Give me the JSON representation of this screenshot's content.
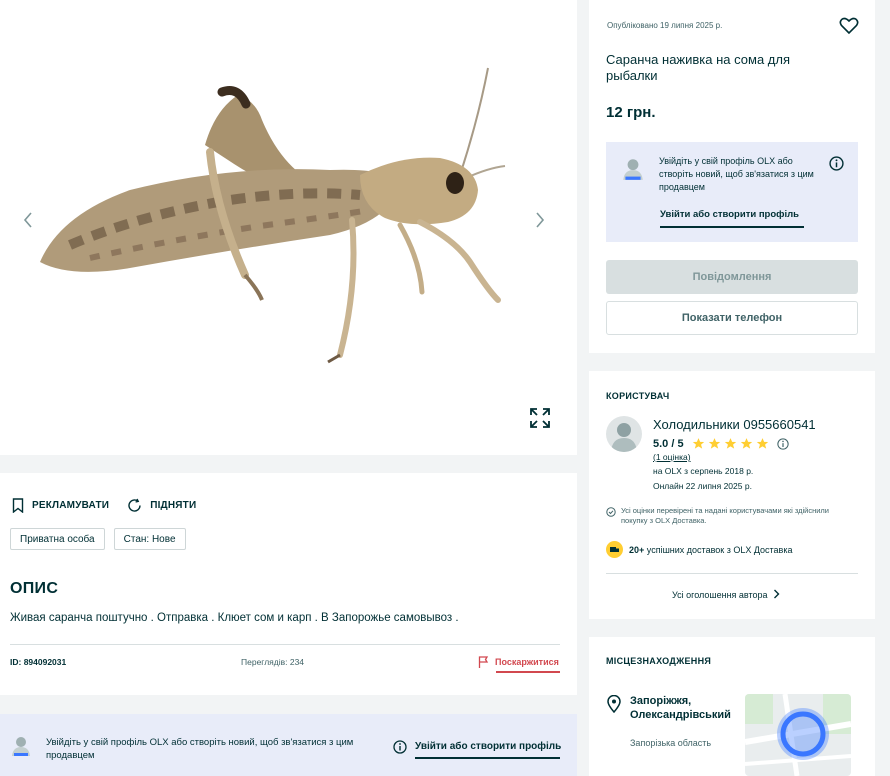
{
  "gallery": {
    "prev_icon": "chevron-left-icon",
    "next_icon": "chevron-right-icon",
    "expand_icon": "expand-icon"
  },
  "details": {
    "promote_label": "РЕКЛАМУВАТИ",
    "raise_label": "ПІДНЯТИ",
    "tags": [
      "Приватна особа",
      "Стан: Нове"
    ],
    "section_title": "ОПИС",
    "description": "Живая саранча поштучно . Отправка . Клюет сом и карп . В Запорожье самовывоз .",
    "id": "ID: 894092031",
    "views": "Переглядів: 234",
    "report_label": "Поскаржитися"
  },
  "banner": {
    "text": "Увійдіть у свій профіль OLX або створіть новий, щоб зв'язатися з цим продавцем",
    "link": "Увійти або створити профіль"
  },
  "listing": {
    "published": "Опубліковано 19 липня 2025 р.",
    "title": "Саранча наживка на сома для рыбалки",
    "price": "12 грн.",
    "login_text": "Увійдіть у свій профіль OLX або створіть новий, щоб зв'язатися з цим продавцем",
    "login_link": "Увійти або створити профіль",
    "message_button": "Повідомлення",
    "phone_button": "Показати телефон"
  },
  "user": {
    "section_label": "КОРИСТУВАЧ",
    "name": "Холодильники 0955660541",
    "rating": "5.0 / 5",
    "stars": 5,
    "reviews": "(1 оцінка)",
    "since": "на OLX з серпень 2018 р.",
    "online": "Онлайн 22 липня 2025 р.",
    "verified_note": "Усі оцінки перевірені та надані користувачами які здійснили покупку з OLX Доставка.",
    "deliveries_bold": "20+",
    "deliveries_rest": "успішних доставок з OLX Доставка",
    "all_ads": "Усі оголошення автора"
  },
  "location": {
    "section_label": "МІСЦЕЗНАХОДЖЕННЯ",
    "city": "Запоріжжя, Олександрівський",
    "region": "Запорізька область"
  },
  "colors": {
    "primary": "#002f34",
    "accent_star": "#ffce32",
    "report": "#d2484f",
    "login_box": "#e8ecf9",
    "map_circle": "#3a77ff"
  }
}
